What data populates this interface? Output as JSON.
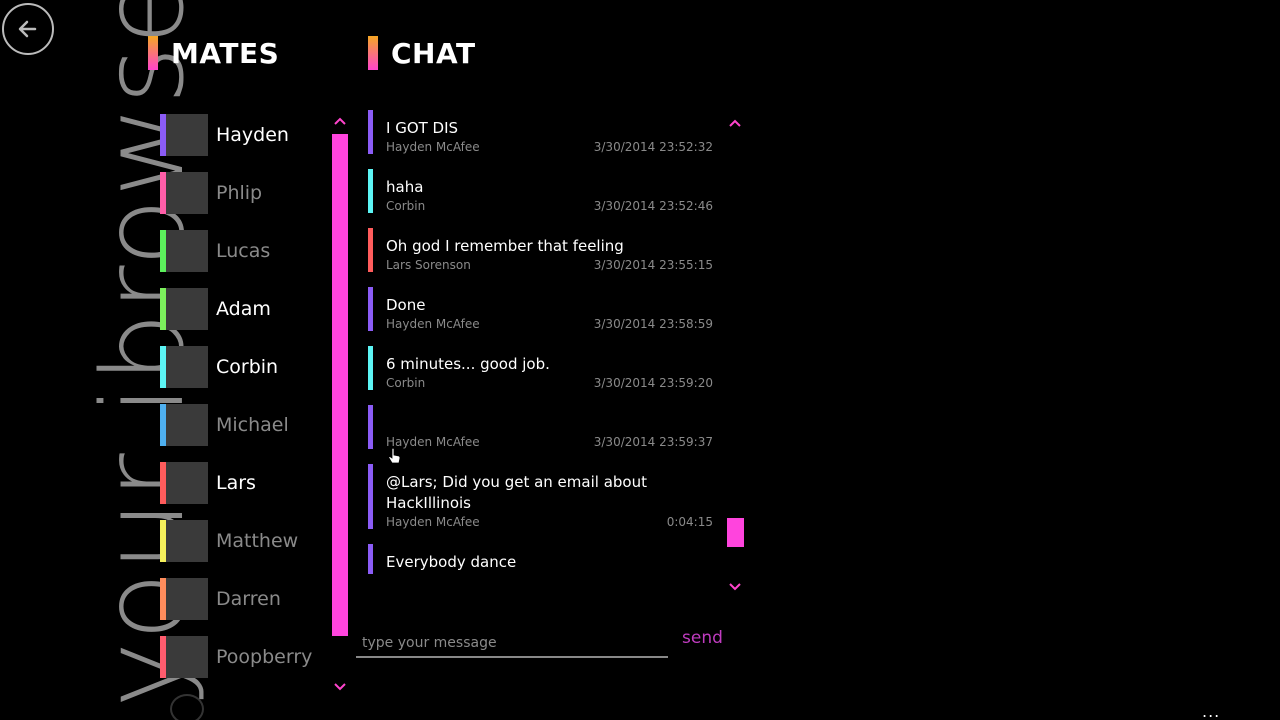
{
  "app_title": "your ibrowse",
  "mates": {
    "heading": "MATES",
    "items": [
      {
        "name": "Hayden",
        "color": "#8b5cf6",
        "status": "online"
      },
      {
        "name": "Phlip",
        "color": "#ff5ea8",
        "status": "offline"
      },
      {
        "name": "Lucas",
        "color": "#5cf05c",
        "status": "offline"
      },
      {
        "name": "Adam",
        "color": "#7cf05c",
        "status": "online"
      },
      {
        "name": "Corbin",
        "color": "#5cf5f5",
        "status": "online"
      },
      {
        "name": "Michael",
        "color": "#4fb0f0",
        "status": "offline"
      },
      {
        "name": "Lars",
        "color": "#ff5c5c",
        "status": "online"
      },
      {
        "name": "Matthew",
        "color": "#f5f05c",
        "status": "offline"
      },
      {
        "name": "Darren",
        "color": "#ff8c5c",
        "status": "offline"
      },
      {
        "name": "Poopberry",
        "color": "#ff5c6e",
        "status": "offline"
      }
    ]
  },
  "chat": {
    "heading": "CHAT",
    "messages": [
      {
        "text": "I GOT DIS",
        "author": "Hayden McAfee",
        "time": "3/30/2014 23:52:32",
        "color": "#8b5cf6"
      },
      {
        "text": "haha",
        "author": "Corbin",
        "time": "3/30/2014 23:52:46",
        "color": "#5cf5f5"
      },
      {
        "text": "Oh god I remember that feeling",
        "author": "Lars Sorenson",
        "time": "3/30/2014 23:55:15",
        "color": "#ff5c5c"
      },
      {
        "text": "Done",
        "author": "Hayden McAfee",
        "time": "3/30/2014 23:58:59",
        "color": "#8b5cf6"
      },
      {
        "text": "6 minutes... good job.",
        "author": "Corbin",
        "time": "3/30/2014 23:59:20",
        "color": "#5cf5f5"
      },
      {
        "text": "",
        "author": "Hayden McAfee",
        "time": "3/30/2014 23:59:37",
        "color": "#8b5cf6"
      },
      {
        "text": "@Lars; Did you get an email about HackIllinois",
        "author": "Hayden McAfee",
        "time": "0:04:15",
        "color": "#8b5cf6"
      },
      {
        "text": "Everybody dance",
        "author": "",
        "time": "",
        "color": "#8b5cf6"
      }
    ]
  },
  "input": {
    "placeholder": "type your message"
  },
  "send_label": "send",
  "more_label": "...",
  "accent_color": "#ff44dd"
}
